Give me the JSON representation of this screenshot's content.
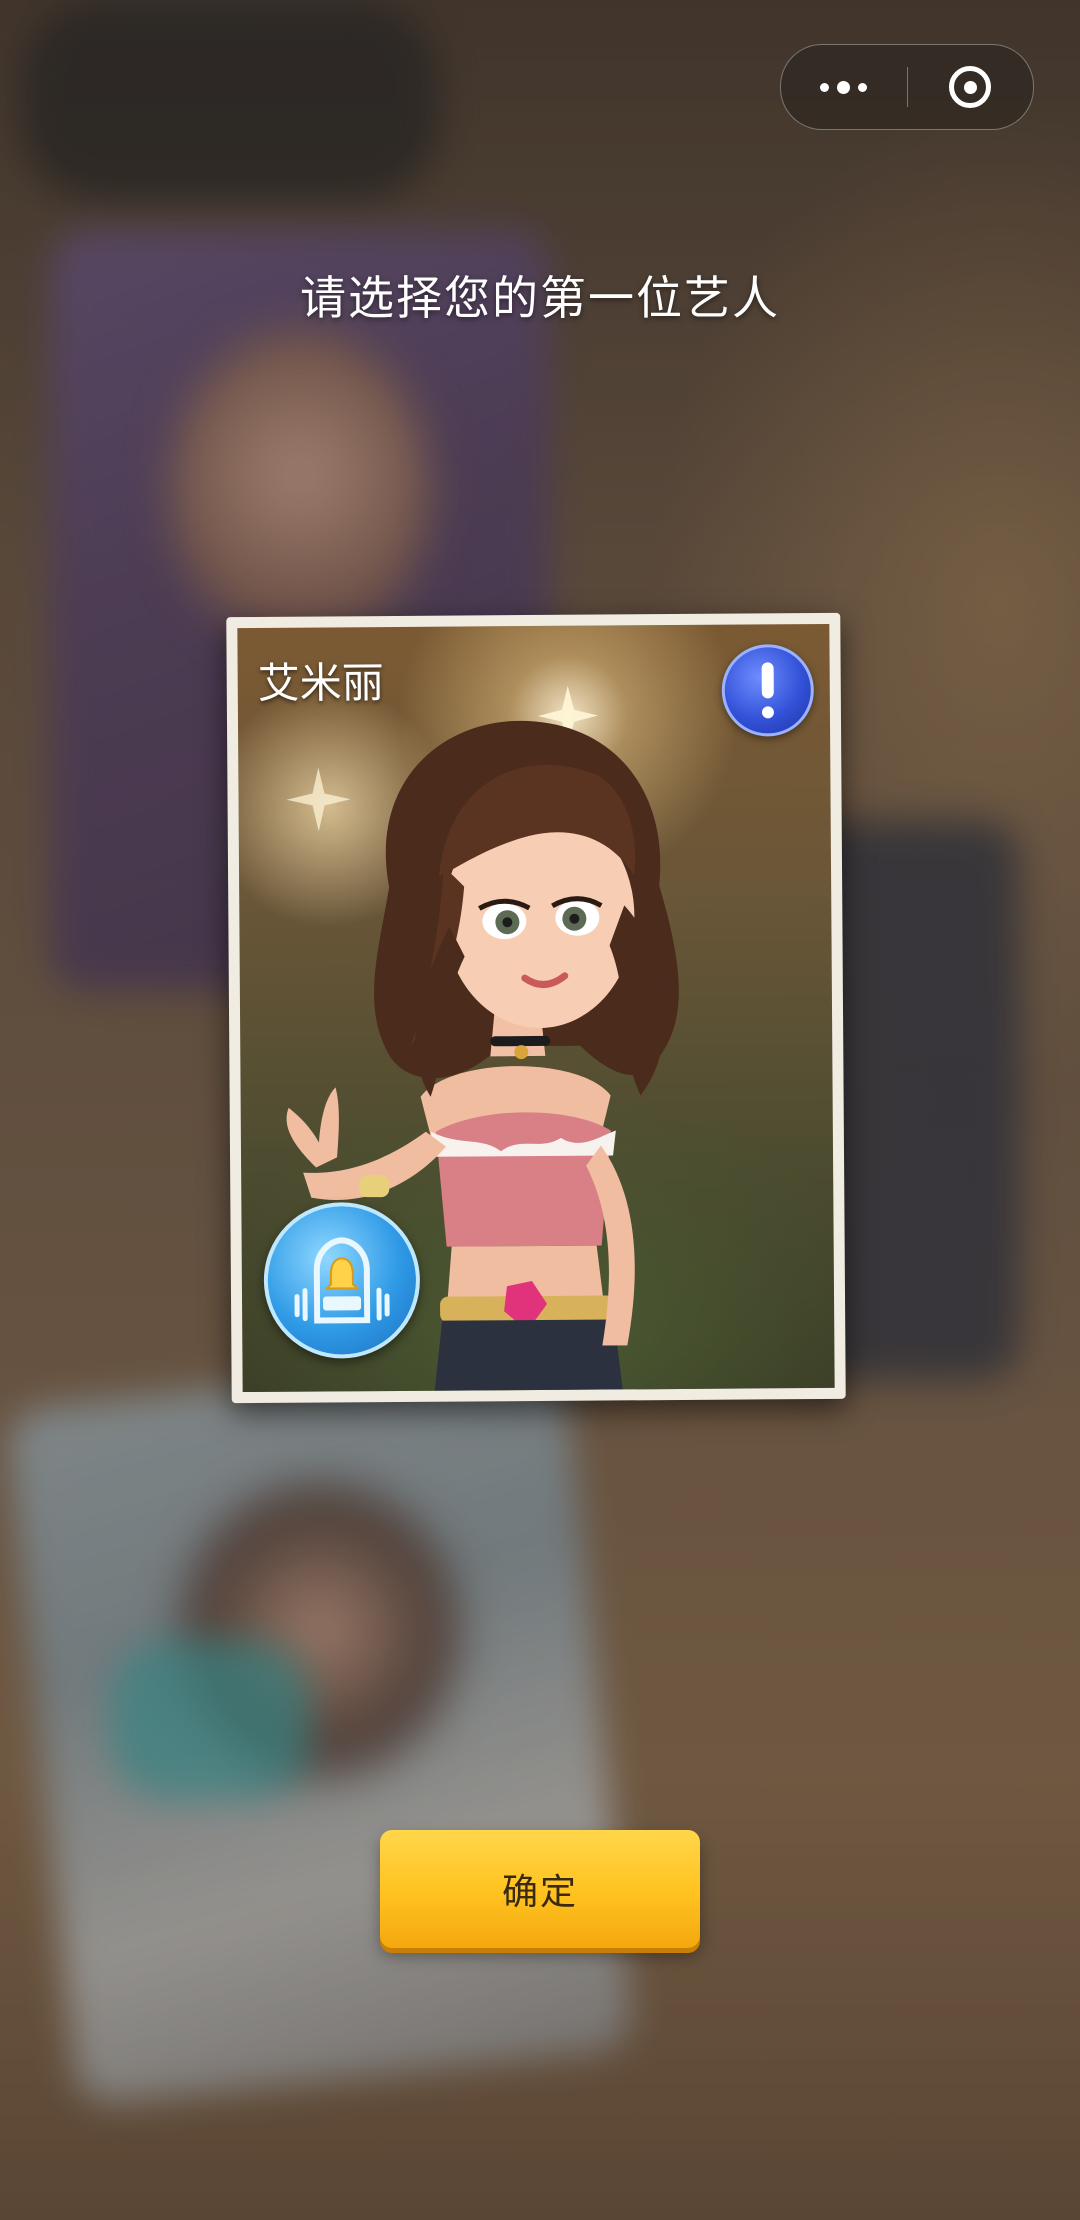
{
  "header": {
    "title": "请选择您的第一位艺人"
  },
  "capsule": {
    "more_icon": "more-dots-icon",
    "close_icon": "target-circle-icon"
  },
  "card": {
    "name": "艾米丽",
    "info_icon": "exclamation-icon",
    "role_icon": "bell-stage-icon",
    "info_color": "#3352d8",
    "role_color": "#2f9ae6"
  },
  "actions": {
    "confirm_label": "确定",
    "confirm_color": "#ffc21f"
  }
}
